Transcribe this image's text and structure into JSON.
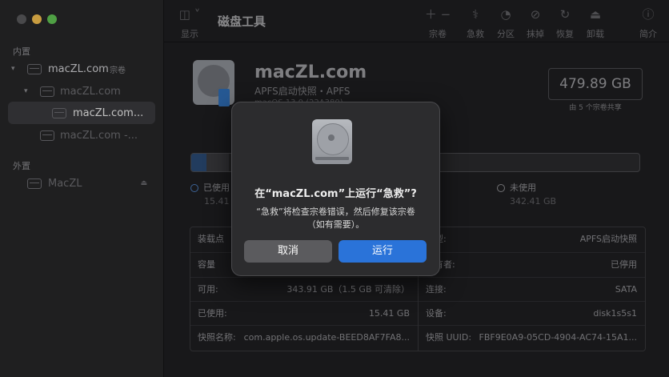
{
  "toolbar": {
    "title": "磁盘工具",
    "view_label": "显示",
    "items": [
      {
        "glyph": "＋ −",
        "label": "宗卷"
      },
      {
        "glyph": "⚕",
        "label": "急救"
      },
      {
        "glyph": "◔",
        "label": "分区"
      },
      {
        "glyph": "⊘",
        "label": "抹掉"
      },
      {
        "glyph": "↻",
        "label": "恢复"
      },
      {
        "glyph": "⏏",
        "label": "卸载"
      },
      {
        "glyph": "ⓘ",
        "label": "简介"
      }
    ]
  },
  "sidebar": {
    "internal_header": "内置",
    "external_header": "外置",
    "items": [
      {
        "label": "macZL.com",
        "badge": "宗卷"
      },
      {
        "label": "macZL.com"
      },
      {
        "label": "macZL.com..."
      },
      {
        "label": "macZL.com -..."
      },
      {
        "label": "MacZL"
      }
    ]
  },
  "volume": {
    "name": "macZL.com",
    "type": "APFS启动快照・APFS",
    "version": "macOS 13.0 (22A380)",
    "capacity": "479.89 GB",
    "capacity_sub": "由 5 个宗卷共享"
  },
  "usage": {
    "used_fraction": 0.034,
    "used_label": "已使用",
    "used_value": "15.41 GB",
    "unused_label": "未使用",
    "unused_value": "342.41 GB"
  },
  "info": {
    "left": [
      {
        "key": "装载点",
        "value": ""
      },
      {
        "key": "容量",
        "value": ""
      },
      {
        "key": "可用:",
        "value": "343.91 GB（1.5 GB 可清除）"
      },
      {
        "key": "已使用:",
        "value": "15.41 GB"
      },
      {
        "key": "快照名称:",
        "value": "com.apple.os.update-BEED8AF7FA8..."
      }
    ],
    "right": [
      {
        "key": "类型:",
        "value": "APFS启动快照"
      },
      {
        "key": "所有者:",
        "value": "已停用"
      },
      {
        "key": "连接:",
        "value": "SATA"
      },
      {
        "key": "设备:",
        "value": "disk1s5s1"
      },
      {
        "key": "快照 UUID:",
        "value": "FBF9E0A9-05CD-4904-AC74-15A1..."
      }
    ]
  },
  "dialog": {
    "title": "在“macZL.com”上运行“急救”?",
    "message": "“急救”将检查宗卷错误，然后修复该宗卷（如有需要）。",
    "cancel_label": "取消",
    "run_label": "运行",
    "accent": "#2a73d9"
  }
}
